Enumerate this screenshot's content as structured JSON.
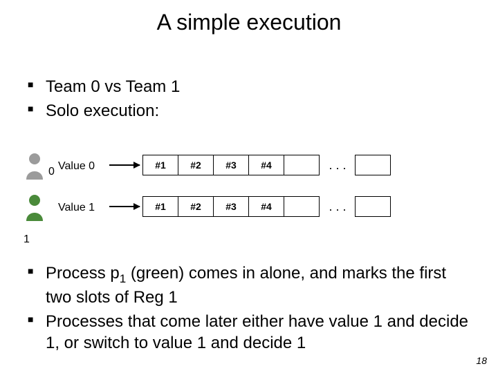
{
  "title": "A simple execution",
  "top_bullets": [
    "Team 0 vs Team 1",
    "Solo execution:"
  ],
  "rows": [
    {
      "person_label": "0",
      "value_label": "Value 0",
      "cells": [
        "#1",
        "#2",
        "#3",
        "#4"
      ],
      "ellipsis": ". . ."
    },
    {
      "person_label": "1",
      "value_label": "Value 1",
      "cells": [
        "#1",
        "#2",
        "#3",
        "#4"
      ],
      "ellipsis": ". . ."
    }
  ],
  "bottom_bullets": [
    {
      "pre": "Process p",
      "sub": "1",
      "post": " (green) comes in alone, and marks the first two slots of Reg 1"
    },
    {
      "pre": "Processes that come later either have value 1 and decide 1, or switch to value 1 and decide 1",
      "sub": "",
      "post": ""
    }
  ],
  "page_number": "18",
  "colors": {
    "gray": "#9b9b9b",
    "green": "#4a8a3a"
  }
}
